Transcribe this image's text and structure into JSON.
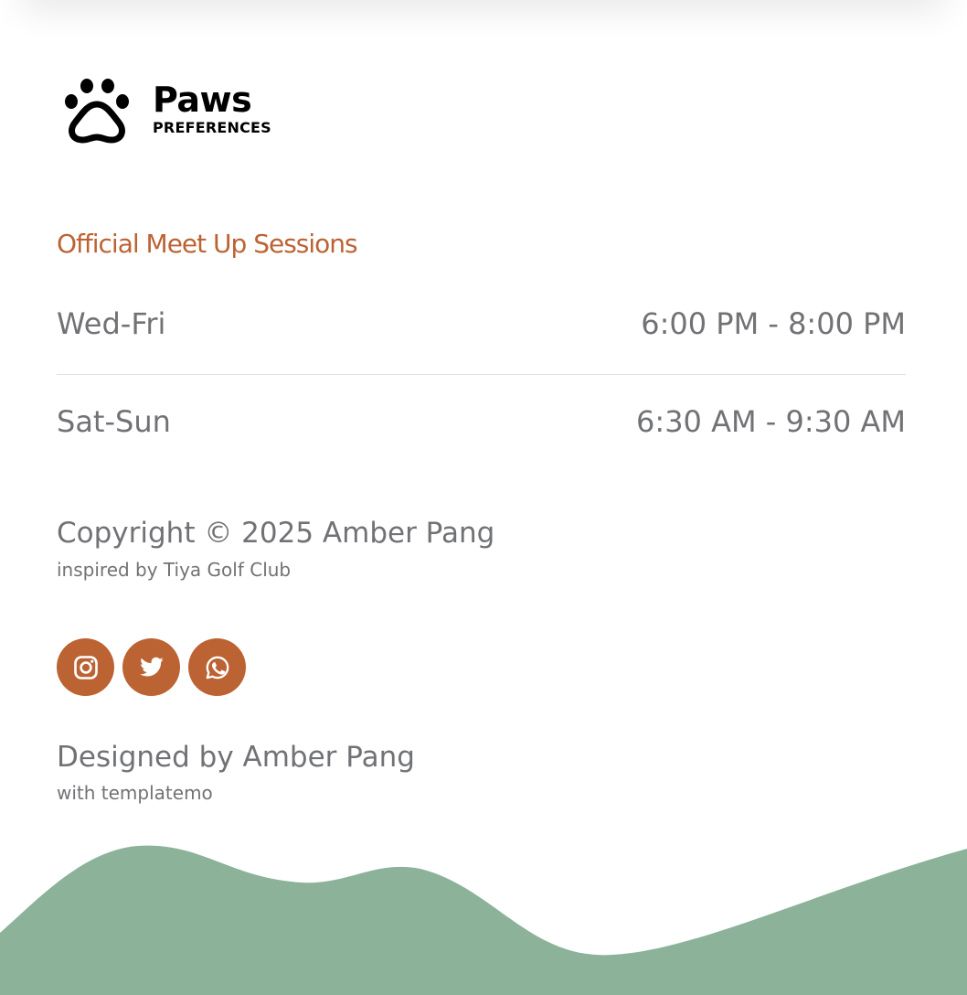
{
  "brand": {
    "name": "Paws",
    "subtitle": "PREFERENCES",
    "icon": "paw-icon"
  },
  "sessions": {
    "title": "Official Meet Up Sessions",
    "rows": [
      {
        "days": "Wed-Fri",
        "time": "6:00 PM - 8:00 PM"
      },
      {
        "days": "Sat-Sun",
        "time": "6:30 AM - 9:30 AM"
      }
    ]
  },
  "footer": {
    "copyright": "Copyright © 2025 Amber Pang",
    "inspired": "inspired by Tiya Golf Club",
    "designed": "Designed by Amber Pang",
    "with": "with templatemo"
  },
  "socials": [
    {
      "name": "instagram",
      "icon": "instagram-icon"
    },
    {
      "name": "twitter",
      "icon": "twitter-icon"
    },
    {
      "name": "whatsapp",
      "icon": "whatsapp-icon"
    }
  ],
  "colors": {
    "accent": "#bc6334",
    "text": "#717275",
    "wave": "#8cb29a",
    "brand_text": "#000000"
  }
}
